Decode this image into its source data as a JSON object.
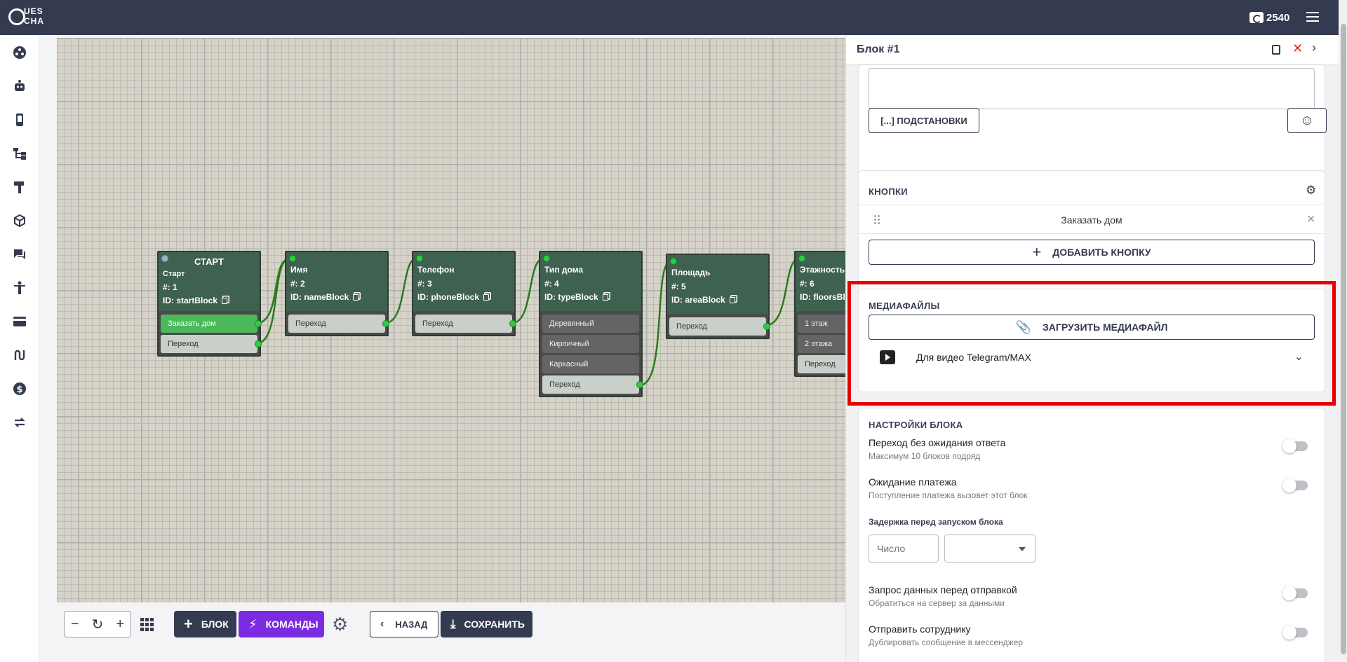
{
  "app": {
    "logo_top": "UES",
    "logo_bottom": "CHA",
    "balance": "2540"
  },
  "sidebar": {
    "icons": [
      "dashboard-icon",
      "robot-icon",
      "phone-icon",
      "sitemap-icon",
      "hammer-icon",
      "cube-icon",
      "chat-icon",
      "person-icon",
      "credit-card-icon",
      "route-icon",
      "dollar-icon",
      "transfer-icon"
    ]
  },
  "flow": {
    "blocks": [
      {
        "title": "СТАРТ",
        "sub": "Старт",
        "num": "#: 1",
        "id": "ID: startBlock",
        "rows": [
          {
            "label": "Заказать дом",
            "kind": "green"
          },
          {
            "label": "Переход",
            "kind": "light"
          }
        ]
      },
      {
        "title": "Имя",
        "num": "#: 2",
        "id": "ID: nameBlock",
        "rows": [
          {
            "label": "Переход",
            "kind": "light"
          }
        ]
      },
      {
        "title": "Телефон",
        "num": "#: 3",
        "id": "ID: phoneBlock",
        "rows": [
          {
            "label": "Переход",
            "kind": "light"
          }
        ]
      },
      {
        "title": "Тип дома",
        "num": "#: 4",
        "id": "ID: typeBlock",
        "rows": [
          {
            "label": "Деревянный",
            "kind": "gray"
          },
          {
            "label": "Кирпичный",
            "kind": "gray"
          },
          {
            "label": "Каркасный",
            "kind": "gray"
          },
          {
            "label": "Переход",
            "kind": "light"
          }
        ]
      },
      {
        "title": "Площадь",
        "num": "#: 5",
        "id": "ID: areaBlock",
        "rows": [
          {
            "label": "Переход",
            "kind": "light"
          }
        ]
      },
      {
        "title": "Этажность",
        "num": "#: 6",
        "id": "ID: floorsBlock",
        "rows": [
          {
            "label": "1 этаж",
            "kind": "gray"
          },
          {
            "label": "2 этажа",
            "kind": "gray"
          },
          {
            "label": "Переход",
            "kind": "light"
          }
        ]
      }
    ]
  },
  "toolbar": {
    "block_label": "БЛОК",
    "commands_label": "КОМАНДЫ",
    "back_label": "НАЗАД",
    "save_label": "СОХРАНИТЬ"
  },
  "panel": {
    "title": "Блок #1",
    "substitutions_label": "[...] ПОДСТАНОВКИ",
    "buttons_title": "КНОПКИ",
    "button_item": "Заказать дом",
    "add_button_label": "ДОБАВИТЬ КНОПКУ",
    "media_title": "МЕДИАФАЙЛЫ",
    "upload_label": "ЗАГРУЗИТЬ МЕДИАФАЙЛ",
    "media_item": "Для видео Telegram/MAX",
    "settings_title": "НАСТРОЙКИ БЛОКА",
    "settings": [
      {
        "label": "Переход без ожидания ответа",
        "hint": "Максимум 10 блоков подряд",
        "enabled": false
      },
      {
        "label": "Ожидание платежа",
        "hint": "Поступление платежа вызовет этот блок",
        "enabled": false
      },
      {
        "label": "Запрос данных перед отправкой",
        "hint": "Обратиться на сервер за данными",
        "enabled": false
      },
      {
        "label": "Отправить сотруднику",
        "hint": "Дублировать сообщение в мессенджер",
        "enabled": false
      }
    ],
    "delay_label": "Задержка перед запуском блока",
    "delay_placeholder": "Число"
  },
  "colors": {
    "topbar": "#343a4f",
    "node_bg": "#3f6150",
    "connector": "#2ecc40",
    "commands": "#7b2be0",
    "highlight": "#e60000"
  }
}
